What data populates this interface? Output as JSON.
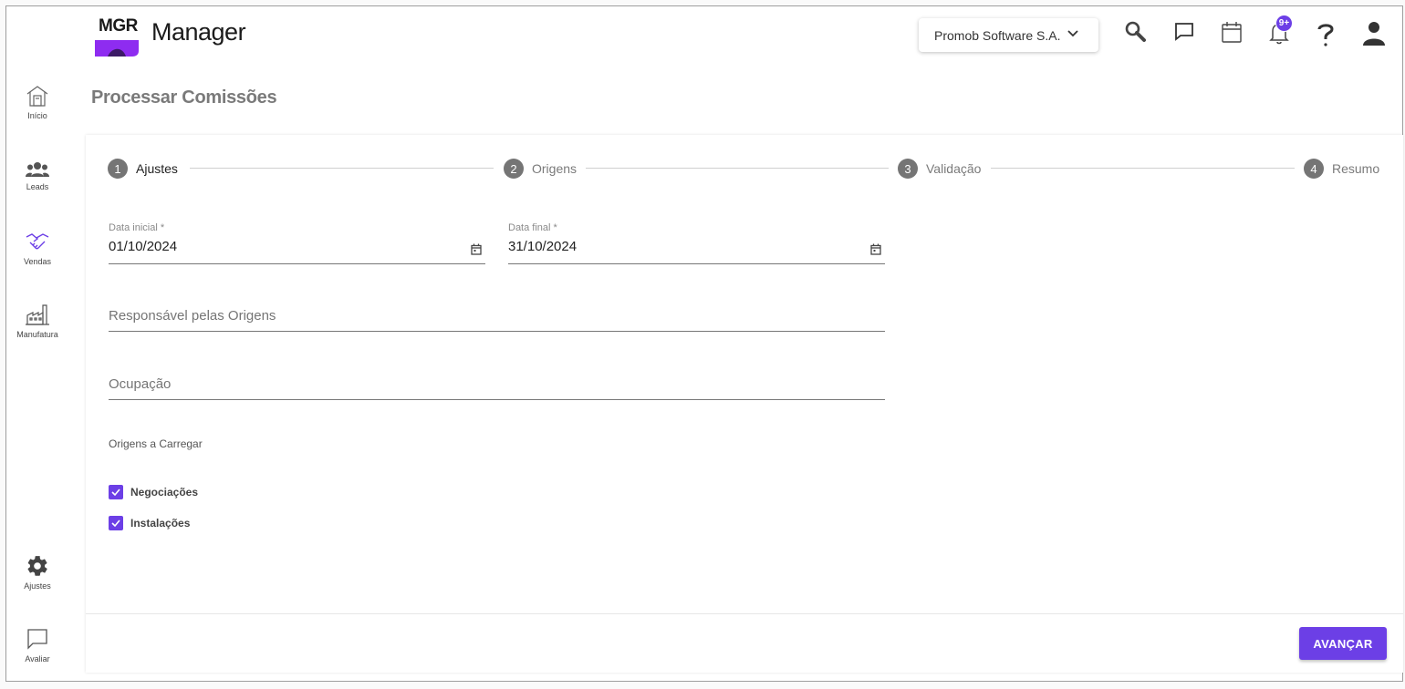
{
  "app": {
    "logo_text": "MGR",
    "brand_name": "Manager"
  },
  "colors": {
    "accent": "#6c3fe6",
    "step_circle": "#757575"
  },
  "sidebar": {
    "items": [
      {
        "label": "Início",
        "icon": "home-icon"
      },
      {
        "label": "Leads",
        "icon": "people-icon"
      },
      {
        "label": "Vendas",
        "icon": "handshake-icon"
      },
      {
        "label": "Manufatura",
        "icon": "factory-icon"
      },
      {
        "label": "Ajustes",
        "icon": "gear-icon"
      },
      {
        "label": "Avaliar",
        "icon": "chat-bubble-icon"
      }
    ]
  },
  "header": {
    "company": "Promob Software S.A.",
    "notifications_badge": "9+",
    "icons": [
      "search-icon",
      "chat-icon",
      "calendar-icon",
      "bell-icon",
      "help-icon",
      "user-icon"
    ]
  },
  "page": {
    "title": "Processar Comissões"
  },
  "stepper": {
    "steps": [
      {
        "num": "1",
        "label": "Ajustes",
        "active": true
      },
      {
        "num": "2",
        "label": "Origens",
        "active": false
      },
      {
        "num": "3",
        "label": "Validação",
        "active": false
      },
      {
        "num": "4",
        "label": "Resumo",
        "active": false
      }
    ]
  },
  "form": {
    "start_date": {
      "label": "Data inicial *",
      "value": "01/10/2024"
    },
    "end_date": {
      "label": "Data final *",
      "value": "31/10/2024"
    },
    "responsible": {
      "placeholder": "Responsável pelas Origens"
    },
    "occupation": {
      "placeholder": "Ocupação"
    },
    "origins_label": "Origens a Carregar",
    "origins": [
      {
        "label": "Negociações",
        "checked": true
      },
      {
        "label": "Instalações",
        "checked": true
      }
    ],
    "next_button": "AVANÇAR"
  }
}
